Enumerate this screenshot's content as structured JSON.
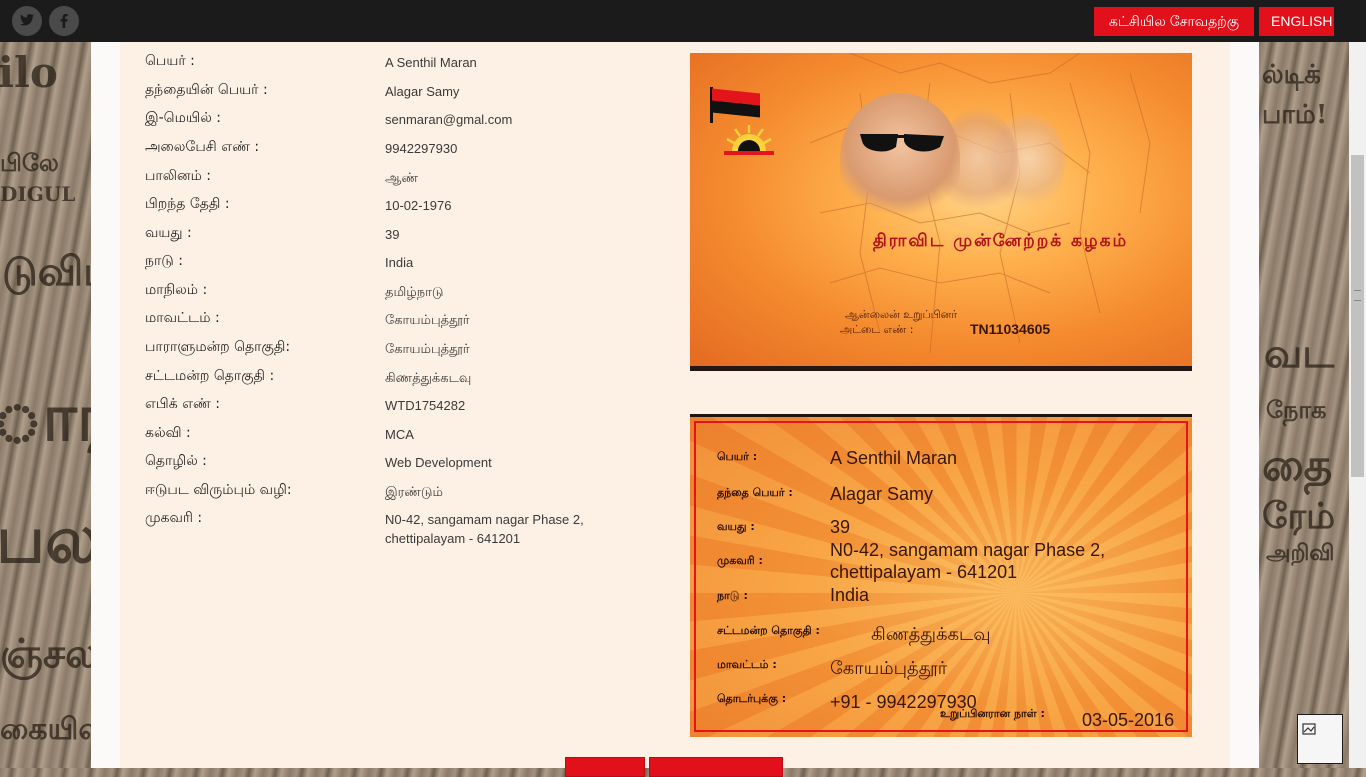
{
  "topbar": {
    "social": [
      {
        "name": "twitter",
        "glyph": "t"
      },
      {
        "name": "facebook",
        "glyph": "f"
      }
    ],
    "join_party_label": "கட்சியில சோவதற்கு",
    "language_label": "ENGLISH"
  },
  "background_newspaper": {
    "left_fragments": [
      "ilo",
      "பிலே",
      "DIGUL",
      "டுவிப",
      "ாரா",
      "பல",
      "ஞ்சல",
      "கையில"
    ],
    "right_fragments": [
      "ல்டிக்",
      "பாம்!",
      "வட",
      "தை",
      "ரேம்",
      "நோக",
      "அறிவி"
    ]
  },
  "profile": {
    "fields": [
      {
        "label": "பெயர் :",
        "value": "A Senthil Maran"
      },
      {
        "label": "தந்தையின் பெயர் :",
        "value": "Alagar Samy"
      },
      {
        "label": "இ-மெயில் :",
        "value": "senmaran@gmal.com"
      },
      {
        "label": "அலைபேசி எண் :",
        "value": "9942297930"
      },
      {
        "label": "பாலினம் :",
        "value": "ஆண்"
      },
      {
        "label": "பிறந்த தேதி :",
        "value": "10-02-1976"
      },
      {
        "label": "வயது :",
        "value": "39"
      },
      {
        "label": "நாடு :",
        "value": "India"
      },
      {
        "label": "மாநிலம் :",
        "value": "தமிழ்நாடு"
      },
      {
        "label": "மாவட்டம் :",
        "value": "கோயம்புத்தூர்"
      },
      {
        "label": "பாராளுமன்ற தொகுதி:",
        "value": "கோயம்புத்தூர்"
      },
      {
        "label": "சட்டமன்ற தொகுதி :",
        "value": "கிணத்துக்கடவு"
      },
      {
        "label": "எபிக் எண் :",
        "value": "WTD1754282"
      },
      {
        "label": "கல்வி :",
        "value": "MCA"
      },
      {
        "label": "தொழில் :",
        "value": "Web Development"
      },
      {
        "label": "ஈடுபட விரும்பும் வழி:",
        "value": "இரண்டும்"
      },
      {
        "label": "முகவரி :",
        "value": "N0-42, sangamam nagar Phase 2, chettipalayam - 641201"
      }
    ]
  },
  "card_front": {
    "party_name": "திராவிட முன்னேற்றக் கழகம்",
    "member_line": "ஆன்லைன் உறுப்பினர்",
    "card_number_label": "அட்டை எண் :",
    "card_number": "TN11034605",
    "colors": {
      "red": "#e3141c",
      "black": "#111111",
      "orange": "#f48a2e"
    }
  },
  "card_back": {
    "rows": [
      {
        "label": "பெயர் :",
        "value": "A Senthil Maran"
      },
      {
        "label": "தந்தை பெயர் :",
        "value": "Alagar Samy"
      },
      {
        "label": "வயது :",
        "value": "39"
      },
      {
        "label": "முகவரி :",
        "value": "N0-42, sangamam nagar Phase 2,\nchettipalayam - 641201"
      },
      {
        "label": "நாடு :",
        "value": "India"
      },
      {
        "label": "சட்டமன்ற தொகுதி :",
        "value": "கிணத்துக்கடவு"
      },
      {
        "label": "மாவட்டம் :",
        "value": "கோயம்புத்தூர்"
      },
      {
        "label": "தொடர்புக்கு :",
        "value": "+91 - 9942297930"
      }
    ],
    "joined_label": "உறுப்பினரான நாள் :",
    "joined_date": "03-05-2016"
  },
  "colors": {
    "accent_red": "#e2101a",
    "panel_bg": "#fdf1e5",
    "topbar": "#1b1b1b"
  }
}
